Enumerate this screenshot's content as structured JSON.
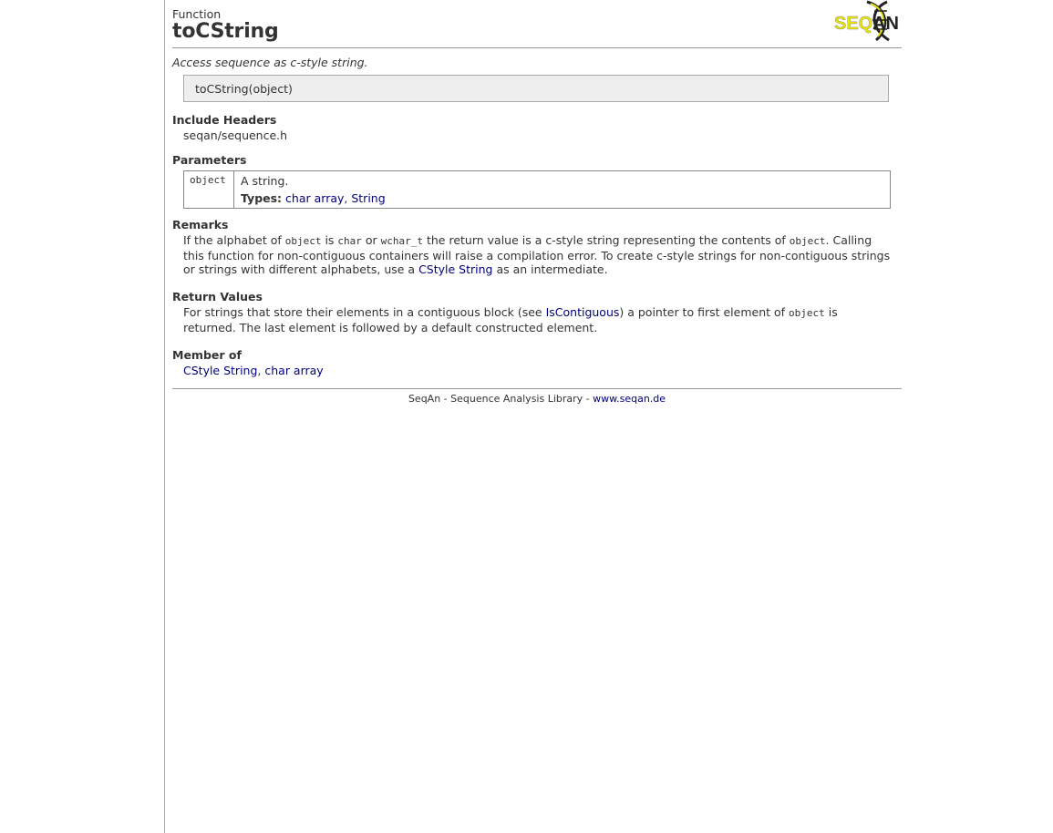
{
  "header": {
    "kind": "Function",
    "title": "toCString",
    "logo_text": "SEQAN"
  },
  "summary": "Access sequence as c-style string.",
  "signature": "toCString(object)",
  "include_headers": {
    "heading": "Include Headers",
    "value": "seqan/sequence.h"
  },
  "parameters": {
    "heading": "Parameters",
    "rows": [
      {
        "name": "object",
        "description": "A string.",
        "types_label": "Types:",
        "types": [
          "char array",
          "String"
        ]
      }
    ]
  },
  "remarks": {
    "heading": "Remarks",
    "t1": "If the alphabet of ",
    "c1": "object",
    "t2": " is ",
    "c2": "char",
    "t3": " or ",
    "c3": "wchar_t",
    "t4": " the return value is a c-style string representing the contents of ",
    "c4": "object",
    "t5": ". Calling this function for non-contiguous containers will raise a compilation error. To create c-style strings for non-contiguous strings or strings with different alphabets, use a ",
    "link": "CStyle String",
    "t6": " as an intermediate."
  },
  "return_values": {
    "heading": "Return Values",
    "t1": "For strings that store their elements in a contiguous block (see ",
    "link": "IsContiguous",
    "t2": ") a pointer to first element of ",
    "c1": "object",
    "t3": " is returned. The last element is followed by a default constructed element."
  },
  "member_of": {
    "heading": "Member of",
    "links": [
      "CStyle String",
      "char array"
    ]
  },
  "footer": {
    "text": "SeqAn - Sequence Analysis Library - ",
    "link": "www.seqan.de"
  },
  "colors": {
    "link": "#00007f",
    "logo_yellow": "#e6e600"
  }
}
